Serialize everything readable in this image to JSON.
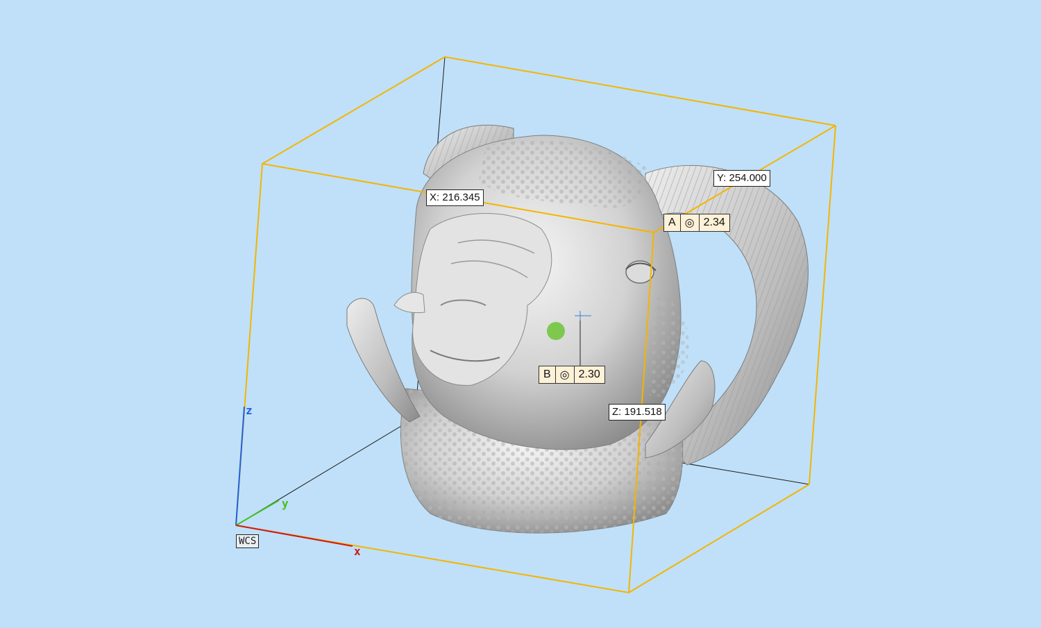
{
  "viewport": {
    "background": "#bfe0f8",
    "bbox_color": "#f5b400",
    "model": "ram-head mesh"
  },
  "dimensions": {
    "x_label": "X: 216.345",
    "y_label": "Y: 254.000",
    "z_label": "Z: 191.518"
  },
  "tolerances": {
    "a": {
      "datum": "A",
      "symbol": "◎",
      "value": "2.34"
    },
    "b": {
      "datum": "B",
      "symbol": "◎",
      "value": "2.30"
    }
  },
  "triad": {
    "wcs_label": "WCS",
    "x_axis": "x",
    "y_axis": "y",
    "z_axis": "z",
    "x_color": "#d01818",
    "y_color": "#44c020",
    "z_color": "#2060e0"
  },
  "marker": {
    "color": "#7ec850"
  }
}
